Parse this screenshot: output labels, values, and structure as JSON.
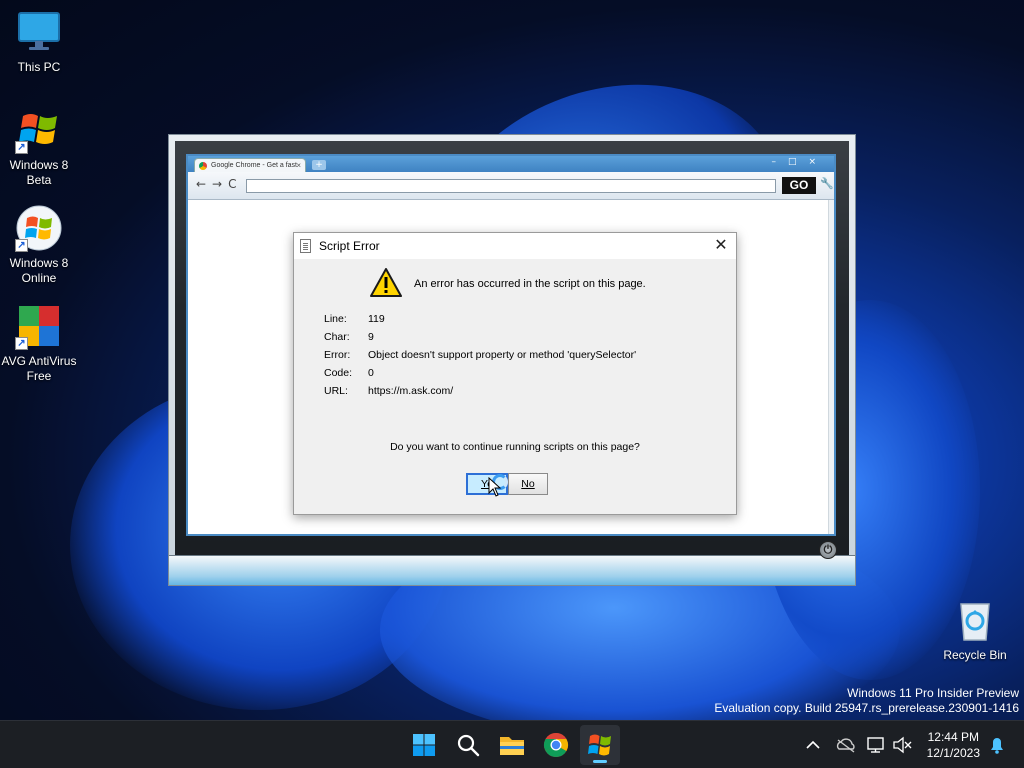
{
  "desktop": {
    "icons": [
      {
        "label": "This PC"
      },
      {
        "label": "Windows 8 Beta"
      },
      {
        "label": "Windows 8 Online"
      },
      {
        "label": "AVG AntiVirus Free"
      },
      {
        "label": "Recycle Bin"
      }
    ],
    "watermark_line1": "Windows 11 Pro Insider Preview",
    "watermark_line2": "Evaluation copy. Build 25947.rs_prerelease.230901-1416"
  },
  "browser": {
    "tab_title": "Google Chrome - Get a fast",
    "tab_close": "×",
    "new_tab": "+",
    "window_buttons": "–□×",
    "nav": "←→C",
    "go_label": "GO",
    "wrench": "🔧"
  },
  "dialog": {
    "title": "Script Error",
    "close": "✕",
    "message": "An error has occurred in the script on this page.",
    "rows": [
      {
        "key": "Line:",
        "value": "119"
      },
      {
        "key": "Char:",
        "value": "9"
      },
      {
        "key": "Error:",
        "value": "Object doesn't support property or method 'querySelector'"
      },
      {
        "key": "Code:",
        "value": "0"
      },
      {
        "key": "URL:",
        "value": "https://m.ask.com/"
      }
    ],
    "question": "Do you want to continue running scripts on this page?",
    "yes_label": "Ye",
    "no_label": "No"
  },
  "taskbar": {
    "clock_time": "12:44 PM",
    "clock_date": "12/1/2023",
    "tray_chevron": "^"
  }
}
